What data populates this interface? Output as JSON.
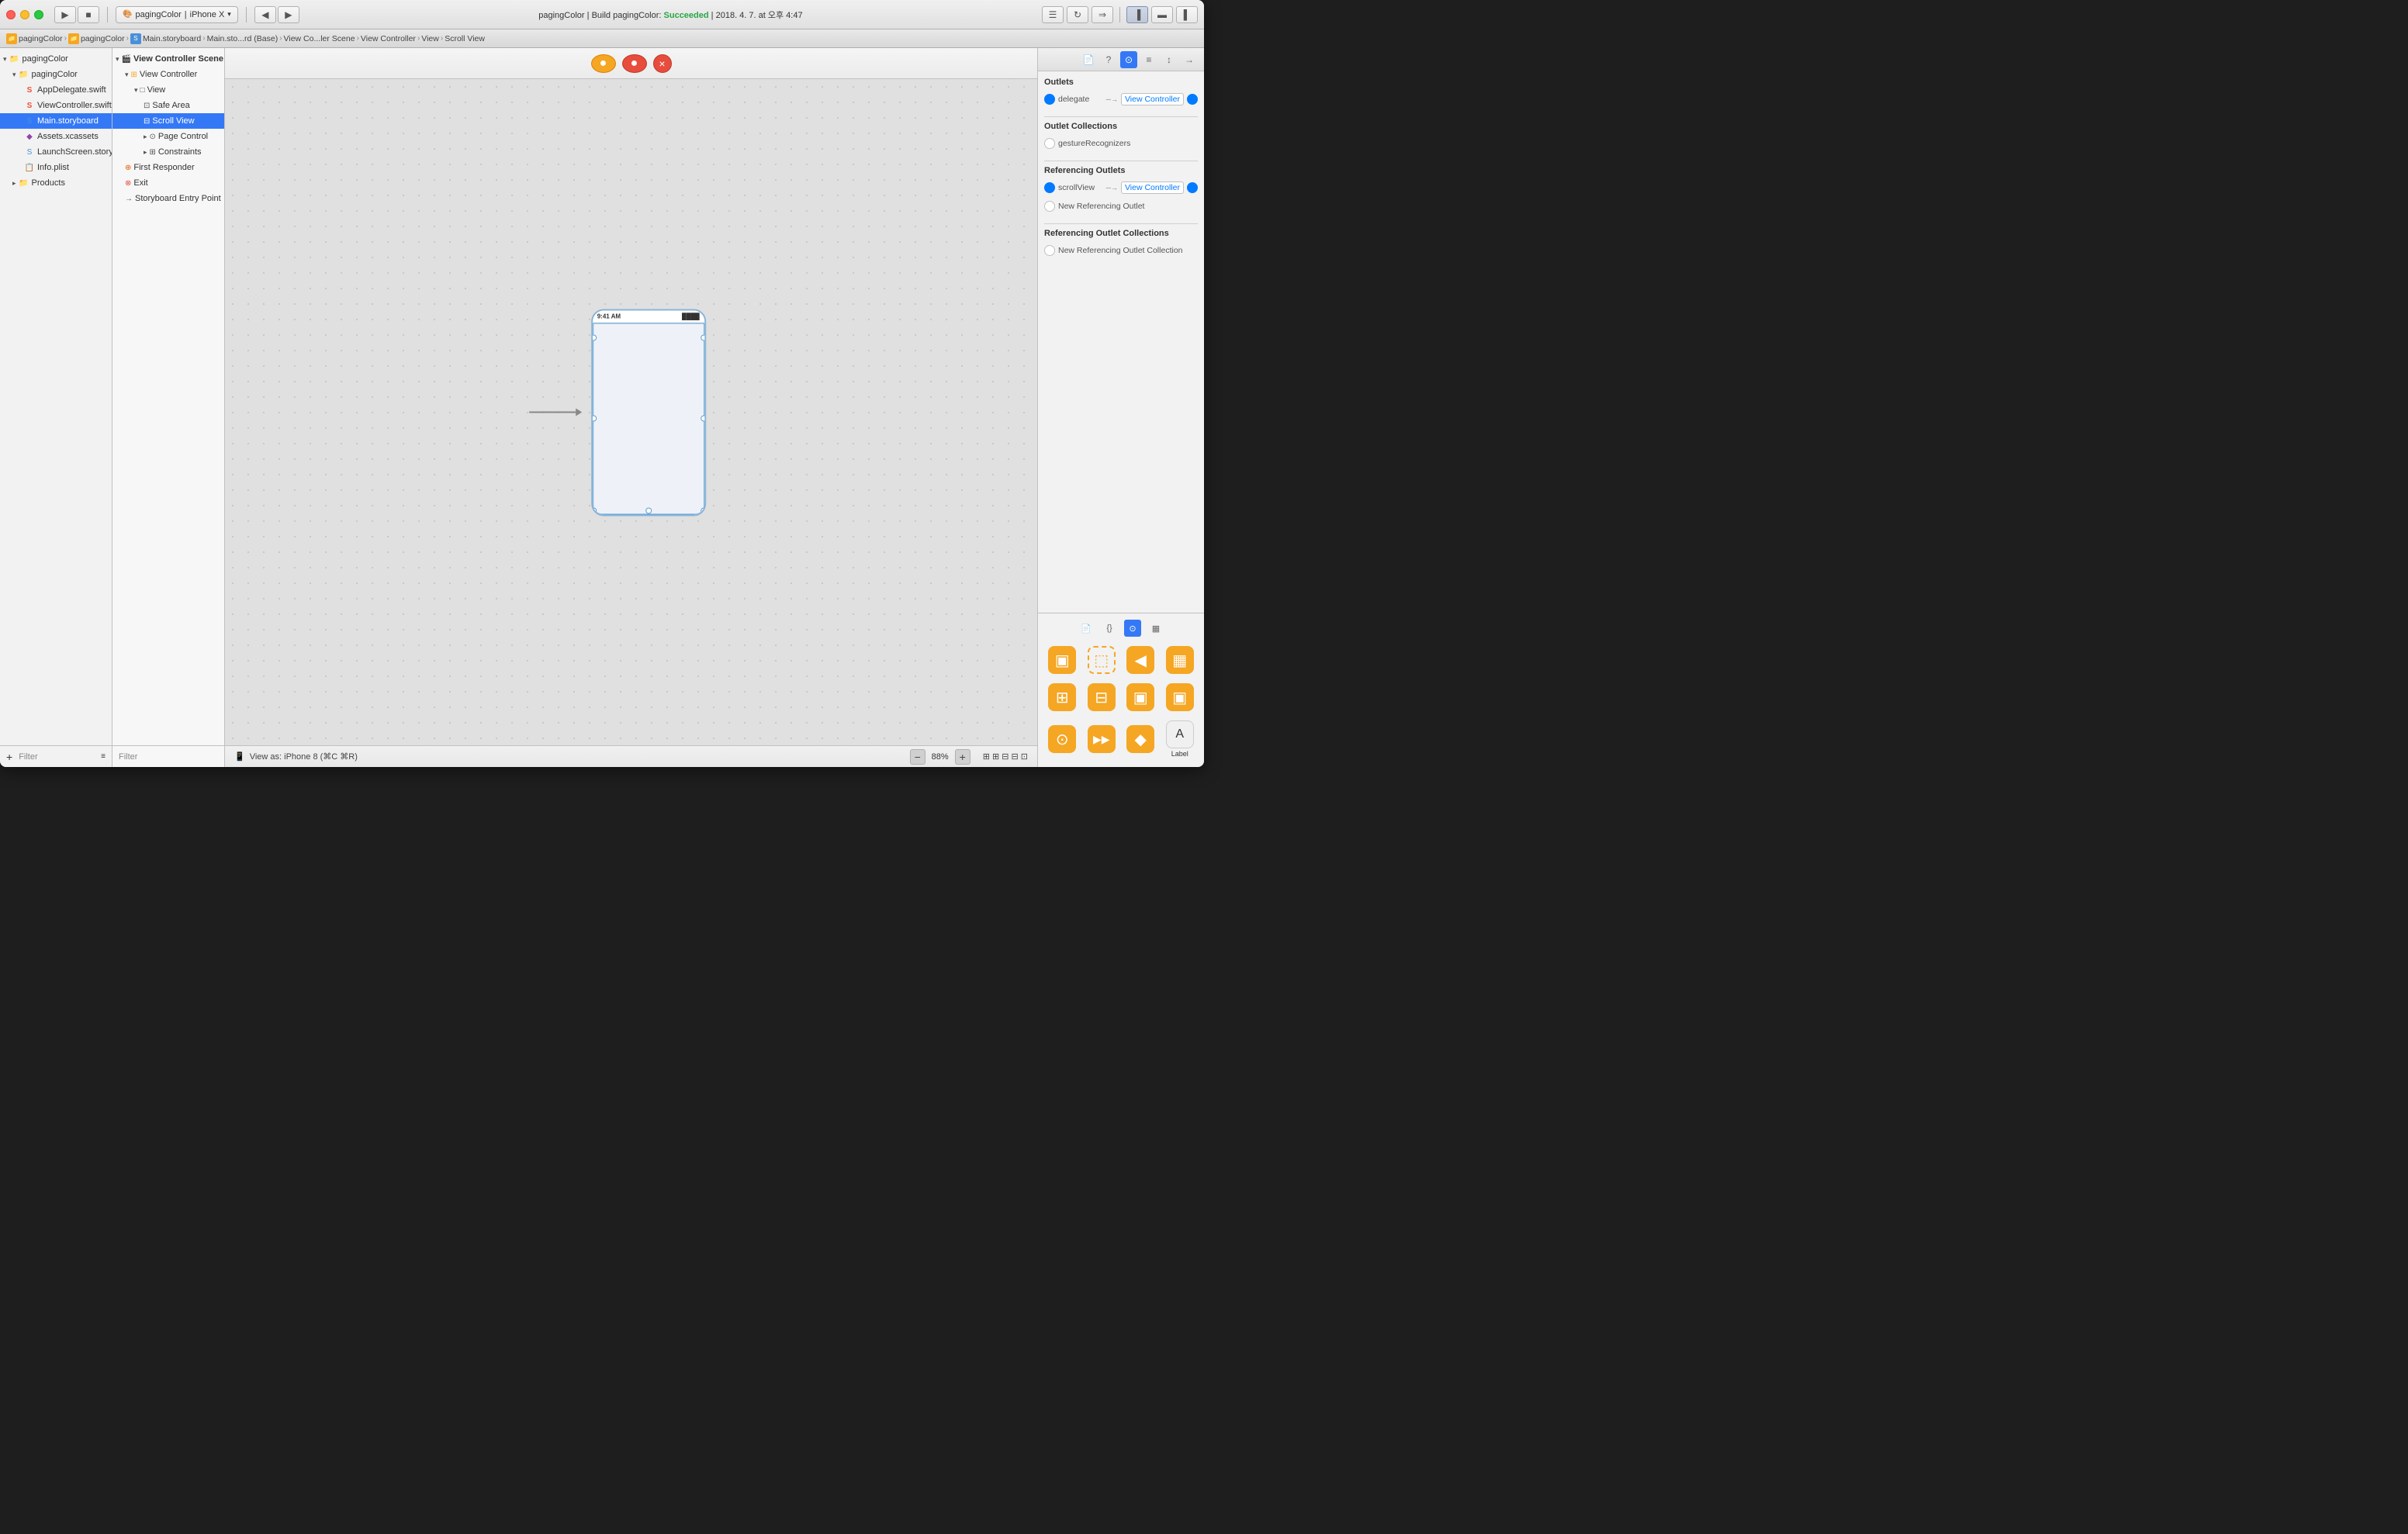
{
  "window": {
    "title": "pagingColor",
    "build_target": "iPhone X",
    "build_status": "Build pagingColor: Succeeded",
    "build_date": "2018. 4. 7. at 오후 4:47"
  },
  "toolbar": {
    "run_label": "▶",
    "stop_label": "■",
    "scheme_label": "pagingColor",
    "device_label": "iPhone X"
  },
  "breadcrumb": {
    "items": [
      "pagingColor",
      "pagingColor",
      "Main.storyboard",
      "Main.sto...rd (Base)",
      "View Co...ler Scene",
      "View Controller",
      "View",
      "Scroll View"
    ]
  },
  "file_navigator": {
    "root": "pagingColor",
    "group": "pagingColor",
    "files": [
      {
        "name": "AppDelegate.swift",
        "type": "swift"
      },
      {
        "name": "ViewController.swift",
        "type": "swift"
      },
      {
        "name": "Main.storyboard",
        "type": "storyboard",
        "selected": true
      },
      {
        "name": "Assets.xcassets",
        "type": "assets"
      },
      {
        "name": "LaunchScreen.storyboard",
        "type": "storyboard"
      },
      {
        "name": "Info.plist",
        "type": "plist"
      }
    ],
    "products_group": "Products",
    "filter_placeholder": "Filter"
  },
  "scene_list": {
    "section_title": "View Controller Scene",
    "items": [
      {
        "name": "View Controller",
        "level": 1,
        "type": "controller",
        "expanded": true
      },
      {
        "name": "View",
        "level": 2,
        "type": "view",
        "expanded": true
      },
      {
        "name": "Safe Area",
        "level": 3,
        "type": "safearea"
      },
      {
        "name": "Scroll View",
        "level": 3,
        "type": "scrollview",
        "selected": true
      },
      {
        "name": "Page Control",
        "level": 3,
        "type": "pagecontrol",
        "expandable": true
      },
      {
        "name": "Constraints",
        "level": 3,
        "type": "constraints",
        "expandable": true
      },
      {
        "name": "First Responder",
        "level": 1,
        "type": "responder"
      },
      {
        "name": "Exit",
        "level": 1,
        "type": "exit"
      },
      {
        "name": "Storyboard Entry Point",
        "level": 1,
        "type": "entry"
      }
    ],
    "filter_placeholder": "Filter"
  },
  "canvas": {
    "view_as": "View as: iPhone 8 (⌘C ⌘R)",
    "zoom": "88%",
    "device_icon": "📱",
    "iphone": {
      "time": "9:41 AM",
      "battery": "████"
    }
  },
  "inspector": {
    "tabs": [
      {
        "id": "file",
        "icon": "📄"
      },
      {
        "id": "quick-help",
        "icon": "?"
      },
      {
        "id": "identity",
        "icon": "⊙"
      },
      {
        "id": "attributes",
        "icon": "≡"
      }
    ],
    "outlets_section": {
      "title": "Outlets",
      "delegate": {
        "label": "delegate",
        "target": "View Controller",
        "connected": true
      }
    },
    "outlet_collections_section": {
      "title": "Outlet Collections",
      "gesture_recognizers": {
        "label": "gestureRecognizers",
        "connected": false
      }
    },
    "referencing_outlets_section": {
      "title": "Referencing Outlets",
      "scroll_view": {
        "label": "scrollView",
        "target": "View Controller",
        "connected": true
      },
      "new_referencing": "New Referencing Outlet"
    },
    "referencing_outlet_collections_section": {
      "title": "Referencing Outlet Collections",
      "new_referencing": "New Referencing Outlet Collection"
    }
  },
  "components": {
    "active_tab": "object-library",
    "tabs": [
      "📄",
      "{}",
      "⊙",
      "▦"
    ],
    "items": [
      {
        "id": "view-controller",
        "icon": "▣",
        "label": ""
      },
      {
        "id": "storyboard-ref",
        "icon": "⬚",
        "label": ""
      },
      {
        "id": "navigation-controller",
        "icon": "◀",
        "label": ""
      },
      {
        "id": "table-view-controller",
        "icon": "▦",
        "label": ""
      },
      {
        "id": "collection-view-controller",
        "icon": "⊞",
        "label": ""
      },
      {
        "id": "split-view-controller",
        "icon": "⊟",
        "label": ""
      },
      {
        "id": "tab-bar-controller",
        "icon": "▣",
        "label": ""
      },
      {
        "id": "page-view-controller",
        "icon": "▣",
        "label": ""
      },
      {
        "id": "av-kit",
        "icon": "⊙",
        "label": ""
      },
      {
        "id": "media-player",
        "icon": "▶▶",
        "label": ""
      },
      {
        "id": "scene-kit",
        "icon": "◆",
        "label": ""
      },
      {
        "id": "label",
        "icon": "A",
        "label": "Label"
      }
    ]
  }
}
